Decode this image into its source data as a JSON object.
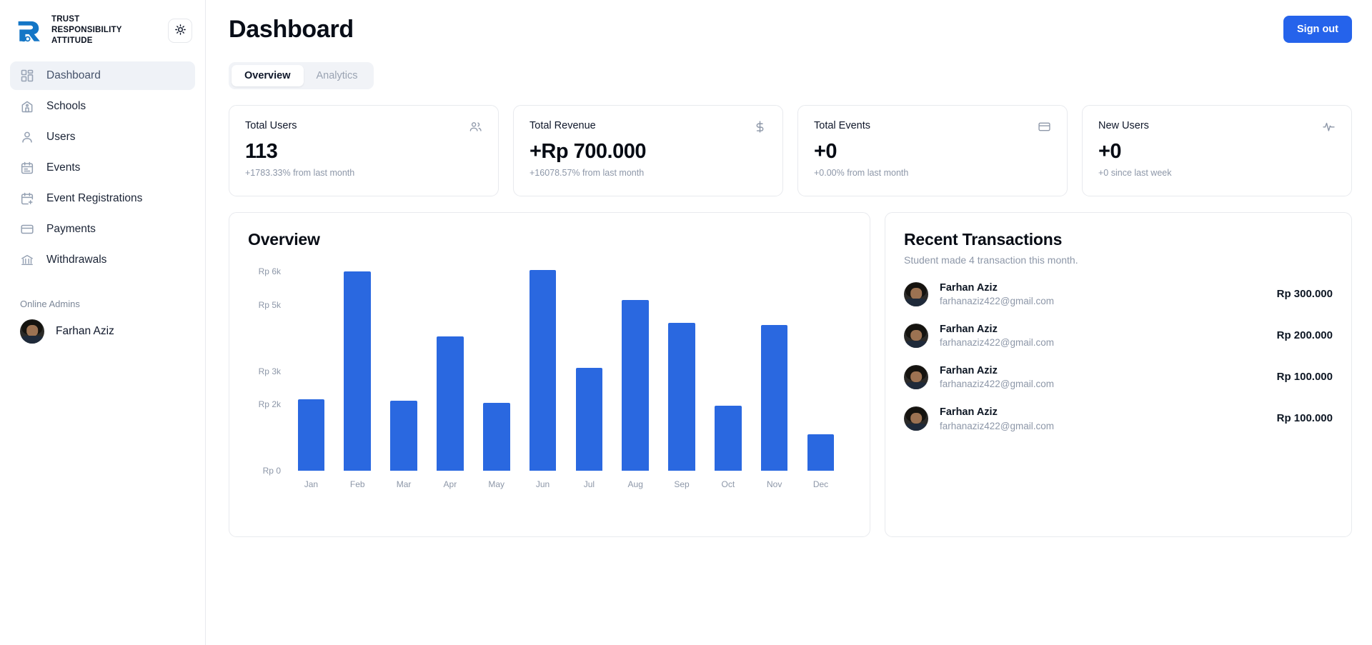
{
  "brand": {
    "name": "TRUST\nRESPONSIBILITY\nATTITUDE",
    "logo_icon": "ra-monogram-logo",
    "theme_toggle_icon": "sun-icon"
  },
  "sidebar": {
    "items": [
      {
        "label": "Dashboard",
        "icon": "grid-dashboard-icon",
        "active": true
      },
      {
        "label": "Schools",
        "icon": "school-building-icon",
        "active": false
      },
      {
        "label": "Users",
        "icon": "user-icon",
        "active": false
      },
      {
        "label": "Events",
        "icon": "calendar-icon",
        "active": false
      },
      {
        "label": "Event Registrations",
        "icon": "calendar-plus-icon",
        "active": false
      },
      {
        "label": "Payments",
        "icon": "credit-card-icon",
        "active": false
      },
      {
        "label": "Withdrawals",
        "icon": "bank-landmark-icon",
        "active": false
      }
    ],
    "online_admins_label": "Online Admins",
    "online_admins": [
      {
        "name": "Farhan Aziz",
        "avatar": "user-photo-avatar"
      }
    ]
  },
  "header": {
    "title": "Dashboard",
    "signout_label": "Sign out",
    "accent_color": "#2563eb"
  },
  "tabs": [
    {
      "label": "Overview",
      "active": true
    },
    {
      "label": "Analytics",
      "active": false
    }
  ],
  "stat_cards": [
    {
      "title": "Total Users",
      "value": "113",
      "sub": "+1783.33% from last month",
      "icon": "users-icon"
    },
    {
      "title": "Total Revenue",
      "value": "+Rp 700.000",
      "sub": "+16078.57% from last month",
      "icon": "dollar-sign-icon"
    },
    {
      "title": "Total Events",
      "value": "+0",
      "sub": "+0.00% from last month",
      "icon": "credit-card-icon"
    },
    {
      "title": "New Users",
      "value": "+0",
      "sub": "+0 since last week",
      "icon": "activity-pulse-icon"
    }
  ],
  "overview": {
    "title": "Overview"
  },
  "chart_data": {
    "type": "bar",
    "title": "Overview",
    "xlabel": "",
    "ylabel": "",
    "categories": [
      "Jan",
      "Feb",
      "Mar",
      "Apr",
      "May",
      "Jun",
      "Jul",
      "Aug",
      "Sep",
      "Oct",
      "Nov",
      "Dec"
    ],
    "values": [
      2150,
      6000,
      2100,
      4050,
      2050,
      6050,
      3100,
      5150,
      4450,
      1950,
      4400,
      1100
    ],
    "ytick_labels": [
      "Rp 6k",
      "Rp 5k",
      "Rp 3k",
      "Rp 2k",
      "Rp 0"
    ],
    "ytick_values": [
      6000,
      5000,
      3000,
      2000,
      0
    ],
    "ylim": [
      0,
      6200
    ],
    "bar_color": "#2a68e0",
    "grid": false,
    "legend": "none"
  },
  "transactions": {
    "title": "Recent Transactions",
    "subtitle": "Student made 4 transaction this month.",
    "rows": [
      {
        "name": "Farhan Aziz",
        "email": "farhanaziz422@gmail.com",
        "amount": "Rp 300.000"
      },
      {
        "name": "Farhan Aziz",
        "email": "farhanaziz422@gmail.com",
        "amount": "Rp 200.000"
      },
      {
        "name": "Farhan Aziz",
        "email": "farhanaziz422@gmail.com",
        "amount": "Rp 100.000"
      },
      {
        "name": "Farhan Aziz",
        "email": "farhanaziz422@gmail.com",
        "amount": "Rp 100.000"
      }
    ]
  }
}
